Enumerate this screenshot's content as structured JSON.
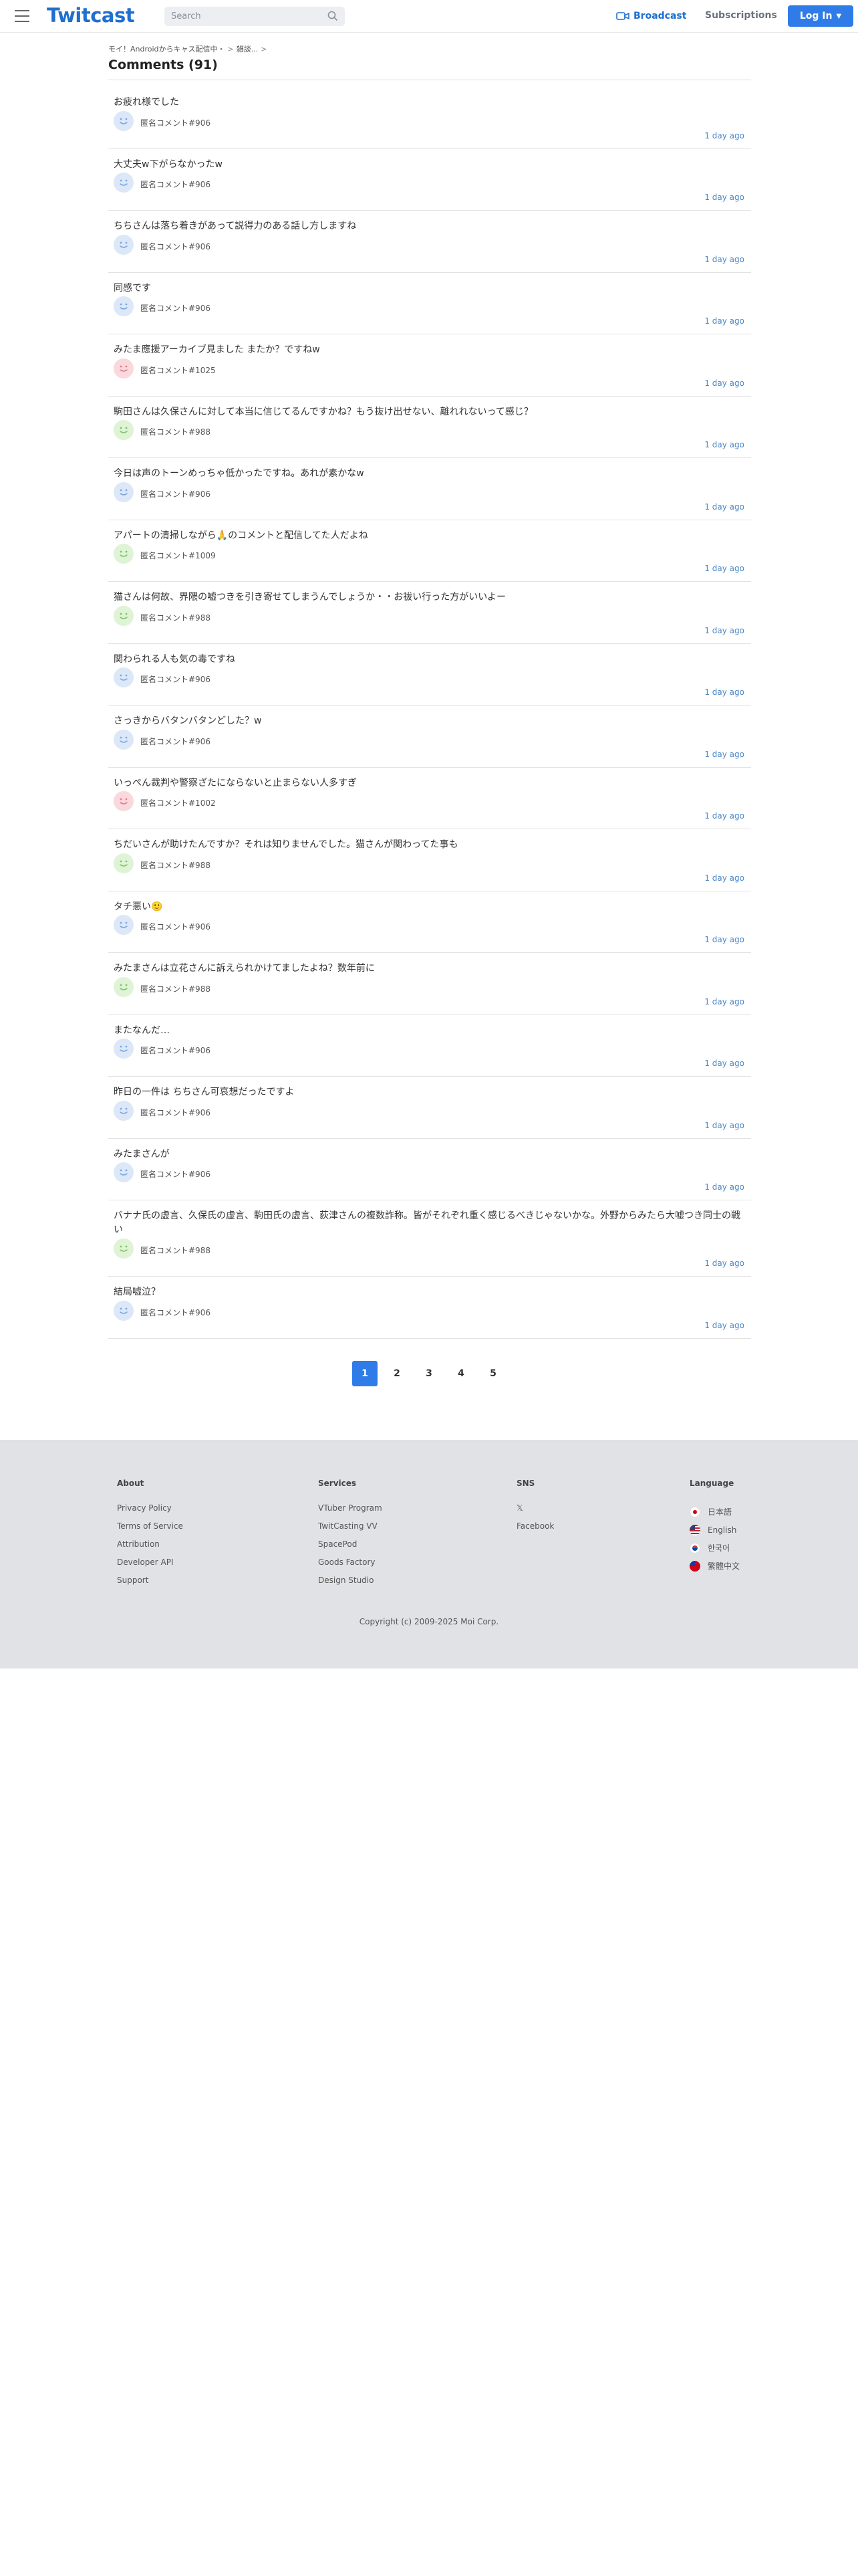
{
  "header": {
    "logo": "Twitcast",
    "search_placeholder": "Search",
    "broadcast_label": "Broadcast",
    "subscriptions_label": "Subscriptions",
    "login_label": "Log In",
    "accent": "#2f7ce8"
  },
  "breadcrumb": {
    "first": "モイ！Androidからキャス配信中・",
    "second": "雑談..."
  },
  "page_title": "Comments (91)",
  "comments": [
    {
      "text": "お疲れ様でした",
      "author": "匿名コメント#906",
      "time": "1 day ago",
      "avatar": "blue"
    },
    {
      "text": "大丈夫w下がらなかったw",
      "author": "匿名コメント#906",
      "time": "1 day ago",
      "avatar": "blue"
    },
    {
      "text": "ちちさんは落ち着きがあって説得力のある話し方しますね",
      "author": "匿名コメント#906",
      "time": "1 day ago",
      "avatar": "blue"
    },
    {
      "text": "同感です",
      "author": "匿名コメント#906",
      "time": "1 day ago",
      "avatar": "blue"
    },
    {
      "text": "みたま應援アーカイブ見ました またか？ですねw",
      "author": "匿名コメント#1025",
      "time": "1 day ago",
      "avatar": "red"
    },
    {
      "text": "駒田さんは久保さんに対して本当に信じてるんですかね？もう抜け出せない、離れれないって感じ？",
      "author": "匿名コメント#988",
      "time": "1 day ago",
      "avatar": "green"
    },
    {
      "text": "今日は声のトーンめっちゃ低かったですね。あれが素かなw",
      "author": "匿名コメント#906",
      "time": "1 day ago",
      "avatar": "blue"
    },
    {
      "text": "アパートの清掃しながら🙏のコメントと配信してた人だよね",
      "author": "匿名コメント#1009",
      "time": "1 day ago",
      "avatar": "green"
    },
    {
      "text": "猫さんは何故、界隈の嘘つきを引き寄せてしまうんでしょうか・・お祓い行った方がいいよー",
      "author": "匿名コメント#988",
      "time": "1 day ago",
      "avatar": "green"
    },
    {
      "text": "関わられる人も気の毒ですね",
      "author": "匿名コメント#906",
      "time": "1 day ago",
      "avatar": "blue"
    },
    {
      "text": "さっきからバタンバタンどした？w",
      "author": "匿名コメント#906",
      "time": "1 day ago",
      "avatar": "blue"
    },
    {
      "text": "いっぺん裁判や警察ざたにならないと止まらない人多すぎ",
      "author": "匿名コメント#1002",
      "time": "1 day ago",
      "avatar": "red"
    },
    {
      "text": "ちだいさんが助けたんですか？それは知りませんでした。猫さんが関わってた事も",
      "author": "匿名コメント#988",
      "time": "1 day ago",
      "avatar": "green"
    },
    {
      "text": "タチ悪い🙂",
      "author": "匿名コメント#906",
      "time": "1 day ago",
      "avatar": "blue"
    },
    {
      "text": "みたまさんは立花さんに訴えられかけてましたよね？数年前に",
      "author": "匿名コメント#988",
      "time": "1 day ago",
      "avatar": "green"
    },
    {
      "text": "またなんだ…",
      "author": "匿名コメント#906",
      "time": "1 day ago",
      "avatar": "blue"
    },
    {
      "text": "昨日の一件は ちちさん可哀想だったですよ",
      "author": "匿名コメント#906",
      "time": "1 day ago",
      "avatar": "blue"
    },
    {
      "text": "みたまさんが",
      "author": "匿名コメント#906",
      "time": "1 day ago",
      "avatar": "blue"
    },
    {
      "text": "バナナ氏の虚言、久保氏の虚言、駒田氏の虚言、荻津さんの複数詐称。皆がそれぞれ重く感じるべきじゃないかな。外野からみたら大嘘つき同士の戦い",
      "author": "匿名コメント#988",
      "time": "1 day ago",
      "avatar": "green",
      "tall": true
    },
    {
      "text": "結局嘘泣？",
      "author": "匿名コメント#906",
      "time": "1 day ago",
      "avatar": "blue"
    }
  ],
  "avatar_colors": {
    "blue": {
      "bg": "#dce8f8",
      "fg": "#7aa6de"
    },
    "red": {
      "bg": "#f9d9dd",
      "fg": "#e07b8a"
    },
    "green": {
      "bg": "#dff3d6",
      "fg": "#7fc46a"
    }
  },
  "pagination": [
    "1",
    "2",
    "3",
    "4",
    "5"
  ],
  "current_page": "1",
  "footer": {
    "about": {
      "title": "About",
      "links": [
        "Privacy Policy",
        "Terms of Service",
        "Attribution",
        "Developer API",
        "Support"
      ]
    },
    "services": {
      "title": "Services",
      "links": [
        "VTuber Program",
        "TwitCasting VV",
        "SpacePod",
        "Goods Factory",
        "Design Studio"
      ]
    },
    "sns": {
      "title": "SNS",
      "links": [
        "𝕏",
        "Facebook"
      ]
    },
    "language": {
      "title": "Language",
      "links": [
        "日本語",
        "English",
        "한국어",
        "繁體中文"
      ]
    },
    "copyright": "Copyright (c) 2009-2025 Moi Corp."
  }
}
